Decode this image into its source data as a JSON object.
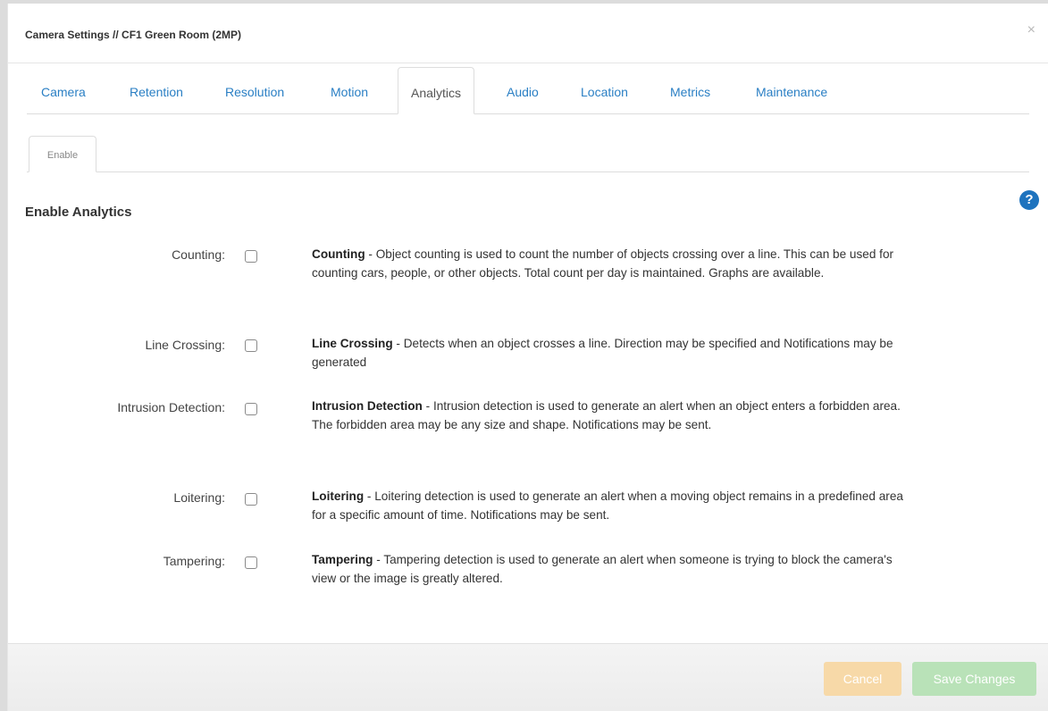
{
  "dialog": {
    "title": "Camera Settings // CF1 Green Room (2MP)",
    "close_glyph": "×"
  },
  "tabs": [
    {
      "label": "Camera"
    },
    {
      "label": "Retention"
    },
    {
      "label": "Resolution"
    },
    {
      "label": "Motion"
    },
    {
      "label": "Analytics"
    },
    {
      "label": "Audio"
    },
    {
      "label": "Location"
    },
    {
      "label": "Metrics"
    },
    {
      "label": "Maintenance"
    }
  ],
  "active_tab": "Analytics",
  "subtabs": [
    {
      "label": "Enable"
    }
  ],
  "section": {
    "title": "Enable Analytics",
    "help_icon": "question-circle-icon",
    "help_glyph": "?"
  },
  "analytics": [
    {
      "label": "Counting:",
      "checked": false,
      "name": "Counting",
      "desc": " - Object counting is used to count the number of objects crossing over a line. This can be used for counting cars, people, or other objects. Total count per day is maintained. Graphs are available."
    },
    {
      "label": "Line Crossing:",
      "checked": false,
      "name": "Line Crossing",
      "desc": " - Detects when an object crosses a line. Direction may be specified and Notifications may be generated"
    },
    {
      "label": "Intrusion Detection:",
      "checked": false,
      "name": "Intrusion Detection",
      "desc": " - Intrusion detection is used to generate an alert when an object enters a forbidden area. The forbidden area may be any size and shape. Notifications may be sent."
    },
    {
      "label": "Loitering:",
      "checked": false,
      "name": "Loitering",
      "desc": " - Loitering detection is used to generate an alert when a moving object remains in a predefined area for a specific amount of time. Notifications may be sent."
    },
    {
      "label": "Tampering:",
      "checked": false,
      "name": "Tampering",
      "desc": " - Tampering detection is used to generate an alert when someone is trying to block the camera's view or the image is greatly altered."
    }
  ],
  "footer": {
    "cancel_label": "Cancel",
    "save_label": "Save Changes"
  },
  "colors": {
    "tab_link": "#2a7fc4",
    "help_icon": "#1e73be",
    "cancel_button": "#f7d9a8",
    "save_button": "#b9e2b8"
  }
}
